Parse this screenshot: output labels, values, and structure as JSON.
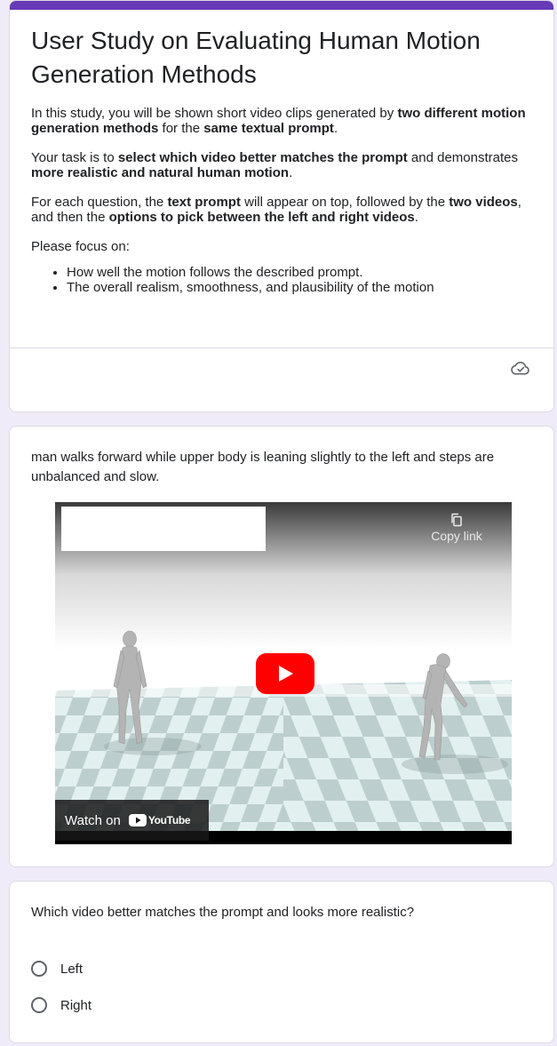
{
  "form": {
    "title": "User Study on Evaluating Human Motion Generation Methods",
    "intro": {
      "p1_a": "In this study, you will be shown short video clips generated by ",
      "p1_b": "two different motion generation methods",
      "p1_c": " for the ",
      "p1_d": "same textual prompt",
      "p1_e": ".",
      "p2_a": "Your task is to ",
      "p2_b": "select which video better matches the prompt",
      "p2_c": " and demonstrates ",
      "p2_d": "more realistic and natural human motion",
      "p2_e": ".",
      "p3_a": "For each question, the ",
      "p3_b": "text prompt",
      "p3_c": " will appear on top, followed by the ",
      "p3_d": "two videos",
      "p3_e": ", and then the ",
      "p3_f": "options to pick between the left and right videos",
      "p3_g": ".",
      "focus": "Please focus on:",
      "bullets": [
        "How well the motion follows the described prompt.",
        "The overall realism, smoothness, and plausibility of the motion"
      ]
    },
    "icons": {
      "save_status": "cloud-check-icon"
    }
  },
  "video_section": {
    "prompt": "man walks forward while upper body is leaning slightly to the left and steps are unbalanced and slow.",
    "player": {
      "copy_link_label": "Copy link",
      "watch_on_label": "Watch on",
      "youtube_word": "YouTube",
      "colors": {
        "play_red": "#ff0000",
        "floor_light": "#dfeeee",
        "floor_dark": "#b8cccc"
      }
    }
  },
  "question": {
    "text": "Which video better matches the prompt and looks more realistic?",
    "options": [
      "Left",
      "Right"
    ]
  },
  "theme": {
    "accent": "#673ab7",
    "background": "#f0ebf8"
  }
}
